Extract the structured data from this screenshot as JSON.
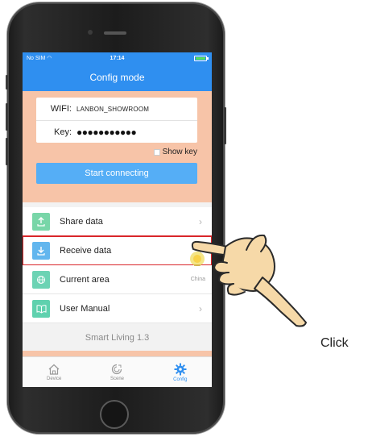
{
  "status": {
    "carrier": "No SIM",
    "wifi_glyph": "◠",
    "time": "17:14",
    "battery_level": 0.85
  },
  "header": {
    "title": "Config mode"
  },
  "config": {
    "wifi_label": "WIFI:",
    "wifi_value": "LANBON_SHOWROOM",
    "key_label": "Key:",
    "key_value": "●●●●●●●●●●●",
    "show_key_label": "Show key",
    "show_key_checked": false,
    "start_label": "Start connecting"
  },
  "menu": {
    "items": [
      {
        "label": "Share data",
        "icon": "upload-icon",
        "icon_color": "#78d6a8",
        "trailing": "chevron"
      },
      {
        "label": "Receive data",
        "icon": "download-icon",
        "icon_color": "#62b6ee",
        "trailing": "chevron",
        "highlighted": true
      },
      {
        "label": "Current area",
        "icon": "globe-icon",
        "icon_color": "#6cd3b4",
        "value": "China"
      },
      {
        "label": "User Manual",
        "icon": "book-icon",
        "icon_color": "#5fd1ae",
        "trailing": "chevron"
      }
    ],
    "chevron": "›"
  },
  "version": "Smart Living 1.3",
  "tabs": [
    {
      "label": "Device",
      "icon": "home-icon",
      "active": false
    },
    {
      "label": "Scene",
      "icon": "scene-icon",
      "active": false
    },
    {
      "label": "Config",
      "icon": "gear-icon",
      "active": true
    }
  ],
  "caption": "Click",
  "colors": {
    "accent": "#2f8ff0",
    "panel": "#f7c4a8",
    "button": "#55aef6",
    "highlight": "#d9262a"
  }
}
